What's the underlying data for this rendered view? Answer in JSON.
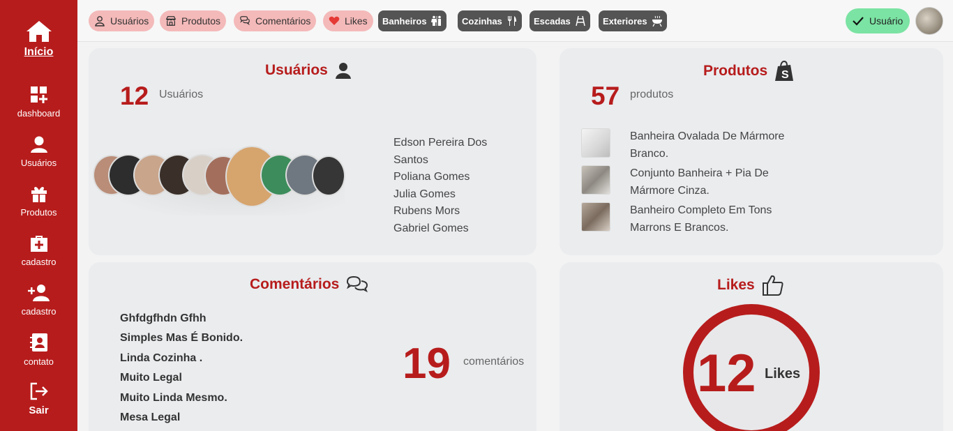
{
  "sidebar": {
    "items": [
      {
        "label": "Início"
      },
      {
        "label": "dashboard"
      },
      {
        "label": "Usuários"
      },
      {
        "label": "Produtos"
      },
      {
        "label": "cadastro"
      },
      {
        "label": "cadastro"
      },
      {
        "label": "contato"
      },
      {
        "label": "Sair"
      }
    ]
  },
  "topbar": {
    "pills": [
      {
        "label": "Usuários",
        "icon": "user-icon"
      },
      {
        "label": "Produtos",
        "icon": "store-icon"
      },
      {
        "label": "Comentários",
        "icon": "chat-icon"
      },
      {
        "label": "Likes",
        "icon": "heart-icon"
      },
      {
        "label": "Banheiros",
        "icon": "restroom-icon"
      },
      {
        "label": "Cozinhas",
        "icon": "utensils-icon"
      },
      {
        "label": "Escadas",
        "icon": "stairs-icon"
      },
      {
        "label": "Exteriores",
        "icon": "grill-icon"
      }
    ],
    "user_label": "Usuário"
  },
  "users": {
    "title": "Usuários",
    "count": "12",
    "count_label": "Usuários",
    "names": [
      "Edson Pereira Dos Santos",
      "Poliana Gomes",
      "Julia Gomes",
      "Rubens Mors",
      "Gabriel Gomes"
    ]
  },
  "products": {
    "title": "Produtos",
    "count": "57",
    "count_label": "produtos",
    "items": [
      {
        "name": "Banheira Ovalada De Mármore Branco."
      },
      {
        "name": "Conjunto Banheira + Pia De Mármore Cinza."
      },
      {
        "name": "Banheiro Completo Em Tons Marrons E Brancos."
      }
    ]
  },
  "comments": {
    "title": "Comentários",
    "count": "19",
    "count_label": "comentários",
    "items": [
      "Ghfdgfhdn Gfhh",
      "Simples Mas É Bonido.",
      "Linda Cozinha .",
      "Muito Legal",
      "Muito Linda Mesmo.",
      "Mesa Legal"
    ]
  },
  "likes": {
    "title": "Likes",
    "count": "12",
    "count_label": "Likes"
  },
  "colors": {
    "brand": "#b71c1c",
    "pill_light": "#f4b9b9",
    "pill_dark": "#545454",
    "user_pill": "#7be3a3",
    "card": "#eaecee"
  }
}
